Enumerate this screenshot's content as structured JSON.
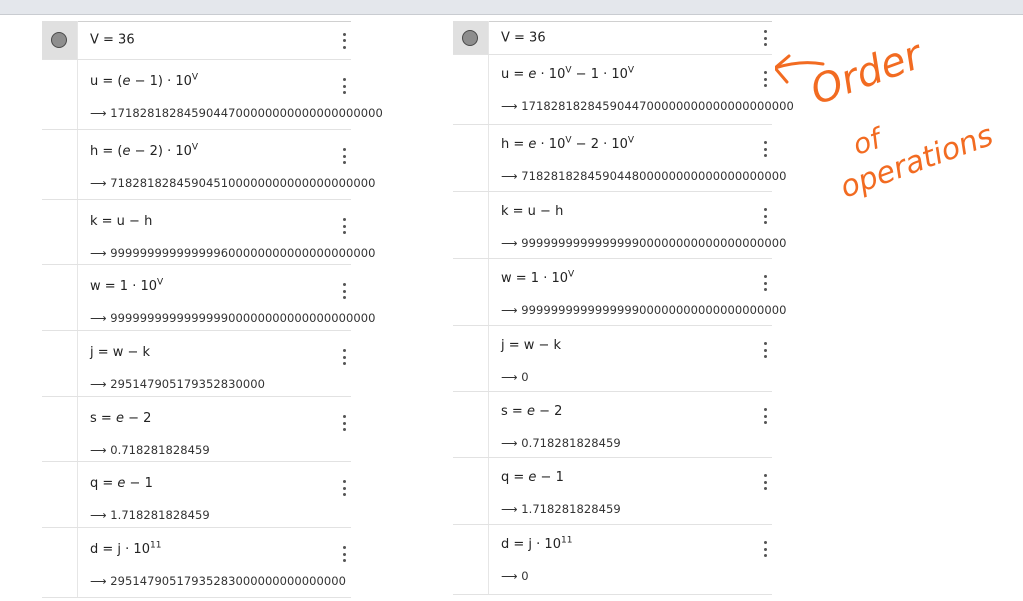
{
  "left_panel": {
    "rows": [
      {
        "formula_html": "V = 36",
        "output": ""
      },
      {
        "formula_html": "u = (<i>e</i> − 1) · 10<sup>V</sup>",
        "output": "⟶ 1718281828459044700000000000000000000"
      },
      {
        "formula_html": "h = (<i>e</i> − 2) · 10<sup>V</sup>",
        "output": "⟶ 718281828459045100000000000000000000"
      },
      {
        "formula_html": "k = u − h",
        "output": "⟶ 999999999999999600000000000000000000"
      },
      {
        "formula_html": "w = 1 · 10<sup>V</sup>",
        "output": "⟶ 999999999999999900000000000000000000"
      },
      {
        "formula_html": "j = w − k",
        "output": "⟶ 295147905179352830000"
      },
      {
        "formula_html": "s = <i>e</i> − 2",
        "output": "⟶ 0.718281828459"
      },
      {
        "formula_html": "q = <i>e</i> − 1",
        "output": "⟶ 1.718281828459"
      },
      {
        "formula_html": "d = j · 10<sup>11</sup>",
        "output": "⟶ 29514790517935283000000000000000"
      }
    ]
  },
  "right_panel": {
    "rows": [
      {
        "formula_html": "V = 36",
        "output": ""
      },
      {
        "formula_html": "u = <i>e</i> · 10<sup>V</sup> − 1 · 10<sup>V</sup>",
        "output": "⟶ 1718281828459044700000000000000000000"
      },
      {
        "formula_html": "h = <i>e</i> · 10<sup>V</sup> − 2 · 10<sup>V</sup>",
        "output": "⟶ 718281828459044800000000000000000000"
      },
      {
        "formula_html": "k = u − h",
        "output": "⟶ 999999999999999900000000000000000000"
      },
      {
        "formula_html": "w = 1 · 10<sup>V</sup>",
        "output": "⟶ 999999999999999900000000000000000000"
      },
      {
        "formula_html": "j = w − k",
        "output": "⟶ 0"
      },
      {
        "formula_html": "s = <i>e</i> − 2",
        "output": "⟶ 0.718281828459"
      },
      {
        "formula_html": "q = <i>e</i> − 1",
        "output": "⟶ 1.718281828459"
      },
      {
        "formula_html": "d = j · 10<sup>11</sup>",
        "output": "⟶ 0"
      }
    ]
  },
  "annotation": {
    "text": "Order of operations",
    "color": "#f26b21"
  },
  "colors": {
    "point_fill": "#8e8e8e",
    "topbar": "#e4e7ec"
  }
}
